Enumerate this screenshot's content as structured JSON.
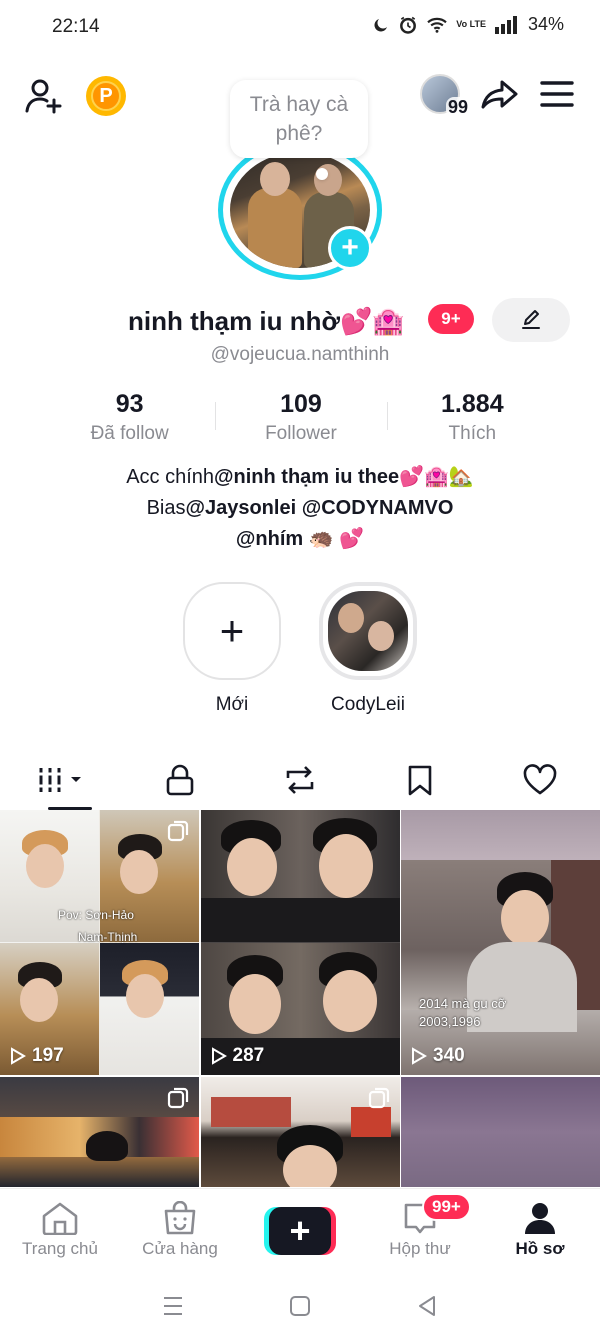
{
  "status_bar": {
    "time": "22:14",
    "battery": "34%",
    "network_label": "Vo LTE"
  },
  "top_bar": {
    "coin_letter": "P",
    "viewer_count": "99"
  },
  "profile": {
    "note": "Trà hay cà phê?",
    "display_name": "ninh thạm iu nhờ💕🏩",
    "name_badge": "9+",
    "username": "@vojeucua.namthinh"
  },
  "stats": [
    {
      "value": "93",
      "label": "Đã follow"
    },
    {
      "value": "109",
      "label": "Follower"
    },
    {
      "value": "1.884",
      "label": "Thích"
    }
  ],
  "bio": {
    "line1_prefix": "Acc chính",
    "line1_mention": "@ninh thạm iu thee💕🏩🏡",
    "line2_prefix": "Bias",
    "line2_mentions": "@Jaysonlei @CODYNAMVO",
    "line3": "@nhím 🦔 💕"
  },
  "highlights": [
    {
      "label": "Mới",
      "icon": "plus-icon"
    },
    {
      "label": "CodyLeii",
      "icon": "photo"
    }
  ],
  "tabs": [
    {
      "icon": "grid-icon",
      "active": true
    },
    {
      "icon": "lock-icon",
      "active": false
    },
    {
      "icon": "repost-icon",
      "active": false
    },
    {
      "icon": "bookmark-icon",
      "active": false
    },
    {
      "icon": "heart-icon",
      "active": false
    }
  ],
  "videos": [
    {
      "views": "197",
      "caption1": "Pov: Sơn-Hảo",
      "caption2": "Nam-Thịnh",
      "multi": true
    },
    {
      "views": "287",
      "multi": false
    },
    {
      "views": "340",
      "caption1": "2014 mà gu cỡ",
      "caption2": "2003,1996",
      "multi": false
    },
    {
      "views": "",
      "multi": true
    },
    {
      "views": "",
      "multi": true
    },
    {
      "views": "",
      "multi": false
    }
  ],
  "bottom_nav": [
    {
      "label": "Trang chủ",
      "icon": "home-icon"
    },
    {
      "label": "Cửa hàng",
      "icon": "shop-icon"
    },
    {
      "label": "",
      "icon": "create-icon"
    },
    {
      "label": "Hộp thư",
      "icon": "inbox-icon",
      "badge": "99+"
    },
    {
      "label": "Hồ sơ",
      "icon": "profile-icon",
      "active": true
    }
  ],
  "colors": {
    "accent_cyan": "#20d5ec",
    "accent_red": "#fe2c55",
    "text_primary": "#161823",
    "text_secondary": "#8a8b91"
  }
}
